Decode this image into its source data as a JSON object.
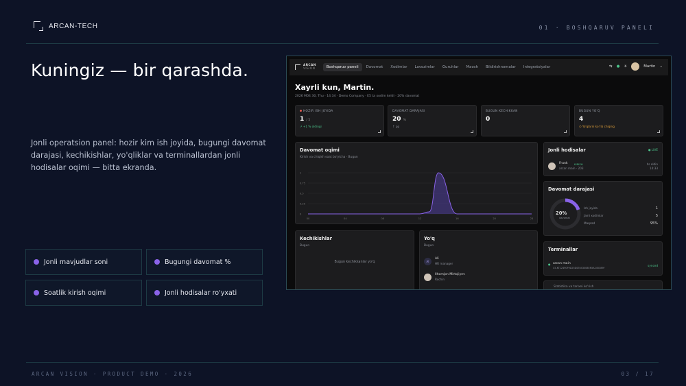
{
  "brand": "ARCAN-TECH",
  "slide_tag": "01 · BOSHQARUV PANELI",
  "headline": "Kuningiz — bir qarashda.",
  "lead": "Jonli operatsion panel: hozir kim ish joyida, bugungi davomat darajasi, kechikishlar, yo'qliklar va terminallardan jonli hodisalar oqimi — bitta ekranda.",
  "features": [
    "Jonli mavjudlar soni",
    "Bugungi davomat %",
    "Soatlik kirish oqimi",
    "Jonli hodisalar ro'yxati"
  ],
  "footer_left": "ARCAN VISION · PRODUCT DEMO · 2026",
  "footer_right": "03 / 17",
  "app": {
    "logo_line1": "ARCAN",
    "logo_line2": "VISION",
    "nav": [
      "Boshqaruv paneli",
      "Davomat",
      "Xodimlar",
      "Lavozimlar",
      "Guruhlar",
      "Maosh",
      "Bildirishnomalar",
      "Integratsiyalar"
    ],
    "user": "Martin",
    "greeting": "Xayrli kun, Martin.",
    "meta": "2026 M04 30, Thu  ·  14:34  ·  Demo Company  ·  E5 ta xodim keldi  ·  20% davomat",
    "kpis": [
      {
        "label": "HOZIR ISH JOYIDA",
        "value": "1",
        "unit": "/ 5",
        "sub": "↗ +1 % oldingi"
      },
      {
        "label": "DAVOMAT DARAJASI",
        "value": "20",
        "unit": "%",
        "sub": "↑ pp"
      },
      {
        "label": "BUGUN KECHIKKAN",
        "value": "0",
        "unit": "",
        "sub": ""
      },
      {
        "label": "BUGUN YO'Q",
        "value": "4",
        "unit": "",
        "sub": "⊙ Yo'qlarni ko'rib chiqing"
      }
    ],
    "flow": {
      "title": "Davomat oqimi",
      "subtitle": "Kirish va chiqish soat bo'yicha · Bugun"
    },
    "events": {
      "title": "Jonli hodisalar",
      "live": "● LIVE",
      "name": "Frank",
      "tag": "KIRISH",
      "detail": "arcan main · 203",
      "time_ago": "hs oldin",
      "time": "14:33"
    },
    "rate": {
      "title": "Davomat darajasi",
      "pct": "20%",
      "pct_sub": "davomat",
      "rows": [
        {
          "label": "Ish joyida",
          "value": "1"
        },
        {
          "label": "Jami xodimlar",
          "value": "5"
        },
        {
          "label": "Maqsad",
          "value": "95%"
        }
      ]
    },
    "late": {
      "title": "Kechikishlar",
      "subtitle": "Bugun",
      "empty": "Bugun kechikkanlar yo'q"
    },
    "absent": {
      "title": "Yo'q",
      "subtitle": "Bugun",
      "people": [
        {
          "initials": "AI",
          "name": "Ali",
          "role": "HR manager"
        },
        {
          "initials": "",
          "name": "Ilhomjon Mirtojiyev",
          "role": "Rochin"
        }
      ]
    },
    "terminals": {
      "title": "Terminallar",
      "name": "arcan main",
      "id": "C5-KT12490F9D25D0E043008EN5A245389F",
      "status": "synced"
    },
    "bottom_hint": "Statistika va tarixni ko'rish"
  },
  "chart_data": {
    "type": "line",
    "x": [
      0,
      2,
      4,
      6,
      8,
      10,
      12,
      13,
      14,
      16,
      18,
      20,
      22,
      24
    ],
    "values": [
      0,
      0,
      0,
      0,
      0,
      0,
      0,
      0.05,
      1,
      0,
      0,
      0,
      0,
      0
    ],
    "xticks": [
      "00",
      "04",
      "08",
      "12",
      "16",
      "20",
      "23"
    ],
    "yticks": [
      "1",
      "0.75",
      "0.5",
      "0.25",
      "0"
    ],
    "ylim": [
      0,
      1
    ],
    "colors": {
      "line": "#8a63e8",
      "fill": "#5b47b8"
    }
  },
  "colors": {
    "accent": "#8a63e8",
    "bg": "#0d1326",
    "good": "#4cc38a",
    "warn": "#e0a03a"
  }
}
